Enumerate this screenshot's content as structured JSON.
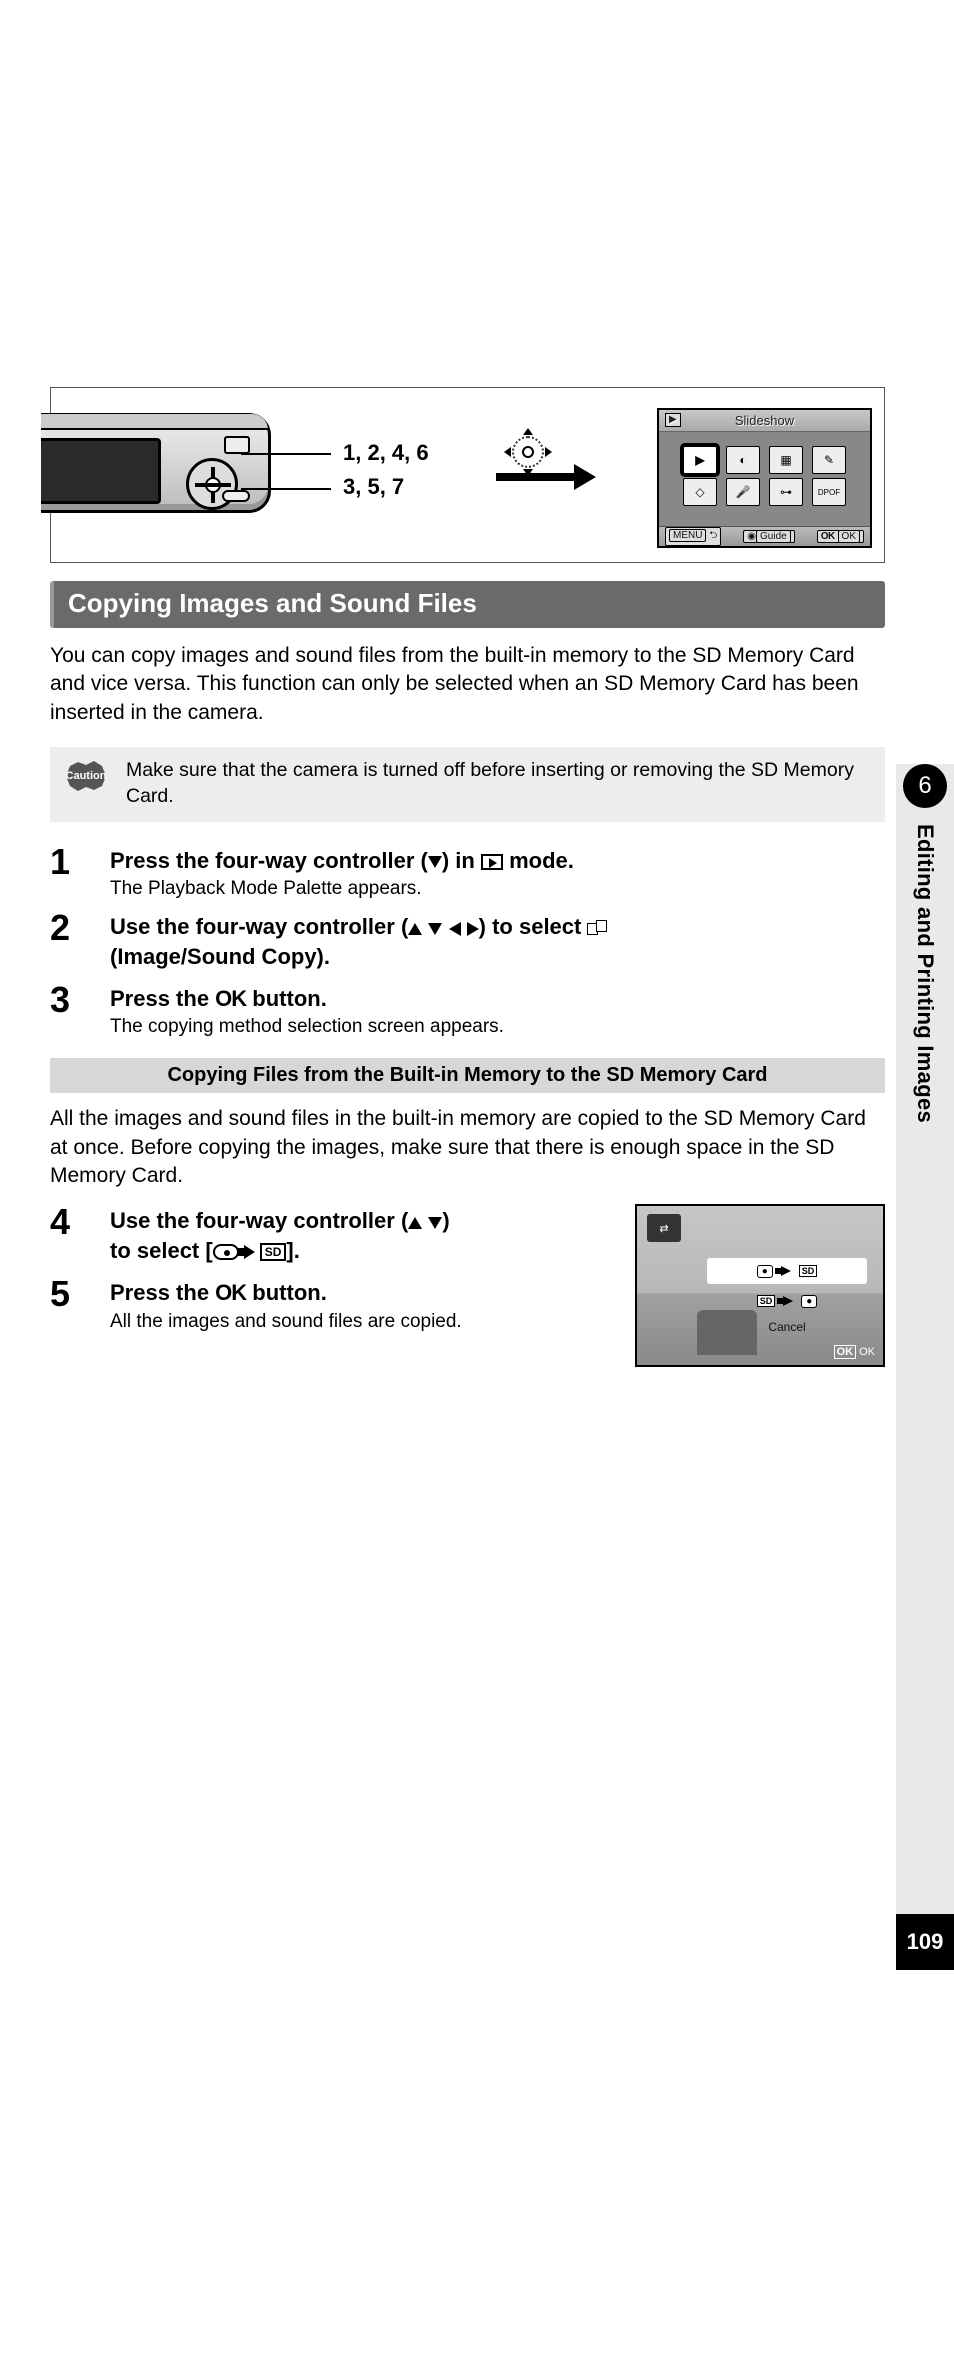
{
  "figure": {
    "step_labels": {
      "line1": "1, 2, 4, 6",
      "line2": "3, 5, 7"
    },
    "lcd": {
      "title": "Slideshow",
      "menu": "MENU",
      "guide": "Guide",
      "ok": "OK",
      "ok2": "OK"
    }
  },
  "section": {
    "title": "Copying Images and Sound Files"
  },
  "intro": "You can copy images and sound files from the built-in memory to the SD Memory Card and vice versa. This function can only be selected when an SD Memory Card has been inserted in the camera.",
  "caution": {
    "label": "Caution",
    "text": "Make sure that the camera is turned off before inserting or removing the SD Memory Card."
  },
  "steps_a": [
    {
      "num": "1",
      "title_pre": "Press the four-way controller (",
      "title_post": ") in ",
      "title_end": " mode.",
      "desc": "The Playback Mode Palette appears."
    },
    {
      "num": "2",
      "title_pre": "Use the four-way controller (",
      "title_post": ") to select ",
      "title_line2": "(Image/Sound Copy)."
    },
    {
      "num": "3",
      "title_pre": "Press the ",
      "title_ok": "OK",
      "title_post": " button.",
      "desc": "The copying method selection screen appears."
    }
  ],
  "subsection": {
    "title": "Copying Files from the Built-in Memory to the SD Memory Card"
  },
  "sub_intro": "All the images and sound files in the built-in memory are copied to the SD Memory Card at once. Before copying the images, make sure that there is enough space in the SD Memory Card.",
  "steps_b": [
    {
      "num": "4",
      "title_pre": "Use the four-way controller (",
      "title_post": ") to select [",
      "title_end": "].",
      "sd": "SD"
    },
    {
      "num": "5",
      "title_pre": "Press the ",
      "title_ok": "OK",
      "title_post": " button.",
      "desc": "All the images and sound files are copied."
    }
  ],
  "screenshot2": {
    "sd": "SD",
    "cancel": "Cancel",
    "ok": "OK",
    "ok2": "OK"
  },
  "side": {
    "chapter": "6",
    "label": "Editing and Printing Images"
  },
  "page_number": "109"
}
